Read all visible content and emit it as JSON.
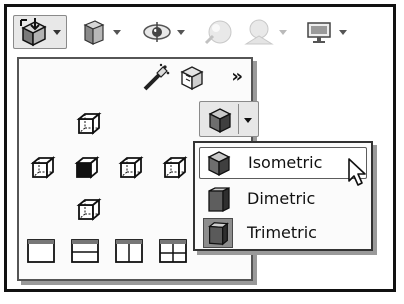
{
  "toolbar": {
    "items": [
      {
        "icon": "view-orientation-icon",
        "has_dropdown": true,
        "active": true
      },
      {
        "icon": "display-style-icon",
        "has_dropdown": true
      },
      {
        "icon": "hide-show-items-icon",
        "has_dropdown": true
      },
      {
        "icon": "edit-appearance-icon",
        "has_dropdown": false,
        "disabled": true
      },
      {
        "icon": "apply-scene-icon",
        "has_dropdown": true,
        "disabled": true
      },
      {
        "icon": "view-settings-icon",
        "has_dropdown": true
      }
    ]
  },
  "dropdown": {
    "top_icons": [
      "camera-view-icon",
      "new-view-icon"
    ],
    "more_glyph": "»",
    "standard_views": [
      "top-view-icon",
      "left-view-icon",
      "front-view-icon",
      "right-view-icon",
      "back-view-icon",
      "bottom-view-icon"
    ],
    "viewport_layouts": [
      "single-view-icon",
      "two-view-horizontal-icon",
      "two-view-vertical-icon",
      "four-view-icon"
    ]
  },
  "submenu": {
    "items": [
      {
        "label": "Isometric",
        "icon": "isometric-icon",
        "highlighted": true
      },
      {
        "label": "Dimetric",
        "icon": "dimetric-icon"
      },
      {
        "label": "Trimetric",
        "icon": "trimetric-icon",
        "selected": true
      }
    ]
  },
  "colors": {
    "cube_face_front": "#6e6e6e",
    "cube_face_top": "#c9c9c9",
    "cube_face_side": "#3f3f3f",
    "outline": "#111111"
  }
}
